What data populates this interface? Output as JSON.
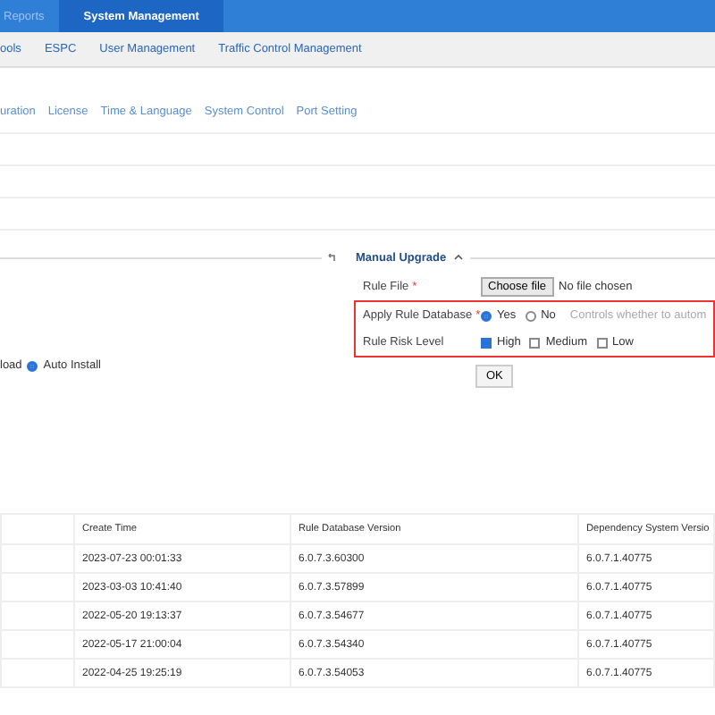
{
  "top_tabs": [
    {
      "label": "Reports",
      "selected": false
    },
    {
      "label": "System Management",
      "selected": true
    }
  ],
  "menu": [
    {
      "label": "ools"
    },
    {
      "label": "ESPC"
    },
    {
      "label": "User Management"
    },
    {
      "label": "Traffic Control Management"
    }
  ],
  "sub_tabs": [
    {
      "label": "uration"
    },
    {
      "label": "License"
    },
    {
      "label": "Time & Language"
    },
    {
      "label": "System Control"
    },
    {
      "label": "Port Setting"
    }
  ],
  "left_panel": {
    "option_text": "load",
    "install": {
      "label": "Auto Install",
      "selected": true
    }
  },
  "manual_upgrade": {
    "title": "Manual Upgrade",
    "rule_file": {
      "label": "Rule File",
      "required_mark": "*",
      "button": "Choose file",
      "status": "No file chosen"
    },
    "apply_rule_database": {
      "label": "Apply Rule Database",
      "required_mark": "*",
      "options": [
        {
          "label": "Yes",
          "selected": true
        },
        {
          "label": "No",
          "selected": false
        }
      ],
      "hint": "Controls whether to autom"
    },
    "rule_risk_level": {
      "label": "Rule Risk Level",
      "options": [
        {
          "label": "High",
          "checked": true
        },
        {
          "label": "Medium",
          "checked": false
        },
        {
          "label": "Low",
          "checked": false
        }
      ]
    },
    "ok_button": "OK"
  },
  "table": {
    "columns": [
      "Create Time",
      "Rule Database Version",
      "Dependency System Versio"
    ],
    "rows": [
      [
        "2023-07-23 00:01:33",
        "6.0.7.3.60300",
        "6.0.7.1.40775"
      ],
      [
        "2023-03-03 10:41:40",
        "6.0.7.3.57899",
        "6.0.7.1.40775"
      ],
      [
        "2022-05-20 19:13:37",
        "6.0.7.3.54677",
        "6.0.7.1.40775"
      ],
      [
        "2022-05-17 21:00:04",
        "6.0.7.3.54340",
        "6.0.7.1.40775"
      ],
      [
        "2022-04-25 19:25:19",
        "6.0.7.3.54053",
        "6.0.7.1.40775"
      ]
    ]
  }
}
